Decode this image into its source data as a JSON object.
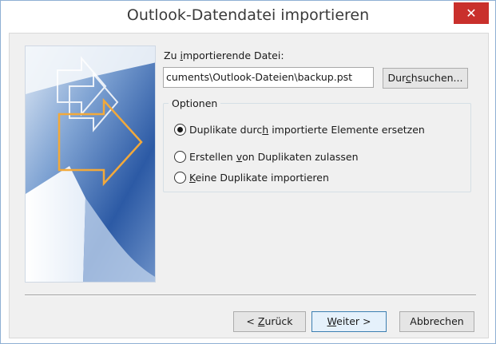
{
  "window": {
    "title": "Outlook-Datendatei importieren",
    "close_label": "✕"
  },
  "file": {
    "label_pre": "Zu ",
    "label_accel": "i",
    "label_post": "mportierende Datei:",
    "value": "cuments\\Outlook-Dateien\\backup.pst",
    "browse_pre": "Dur",
    "browse_accel": "c",
    "browse_post": "hsuchen..."
  },
  "options": {
    "legend": "Optionen",
    "items": [
      {
        "pre": "Duplikate durc",
        "accel": "h",
        "post": " importierte Elemente ersetzen",
        "checked": true
      },
      {
        "pre": "Erstellen ",
        "accel": "v",
        "post": "on Duplikaten zulassen",
        "checked": false
      },
      {
        "pre": "",
        "accel": "K",
        "post": "eine Duplikate importieren",
        "checked": false
      }
    ]
  },
  "buttons": {
    "back_pre": "< ",
    "back_accel": "Z",
    "back_post": "urück",
    "next_accel": "W",
    "next_post": "eiter >",
    "cancel": "Abbrechen"
  },
  "colors": {
    "close_button": "#c9302c",
    "image_blue": "#2f5fa6",
    "arrow_orange": "#f2a93b"
  },
  "icons": {
    "close": "close-icon",
    "wizard_graphic": "import-arrows-graphic"
  }
}
